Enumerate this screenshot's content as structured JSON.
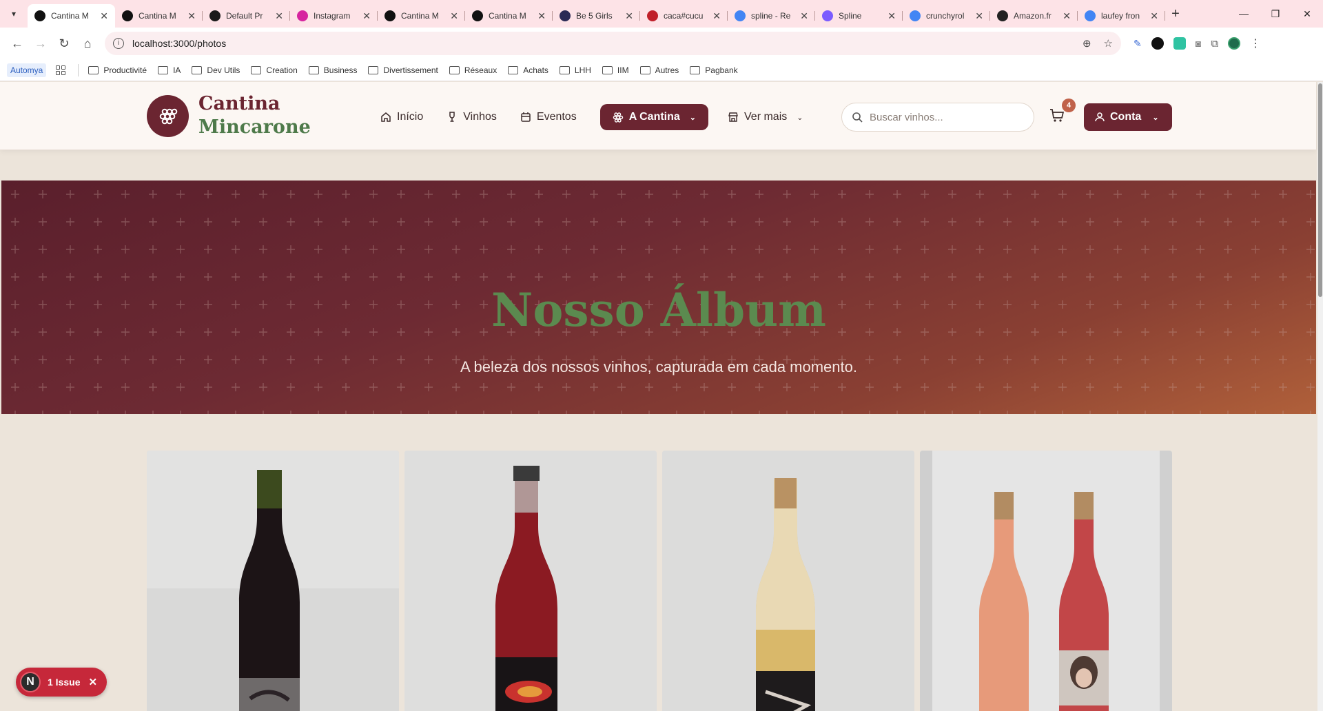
{
  "browser": {
    "tabs": [
      {
        "title": "Cantina M",
        "active": true,
        "favicon_color": "#111111"
      },
      {
        "title": "Cantina M",
        "active": false,
        "favicon_color": "#111111"
      },
      {
        "title": "Default Pr",
        "active": false,
        "favicon_color": "#1a1a1a"
      },
      {
        "title": "Instagram",
        "active": false,
        "favicon_color": "#d6249f"
      },
      {
        "title": "Cantina M",
        "active": false,
        "favicon_color": "#111111"
      },
      {
        "title": "Cantina M",
        "active": false,
        "favicon_color": "#111111"
      },
      {
        "title": "Be 5 Girls",
        "active": false,
        "favicon_color": "#2a2a55"
      },
      {
        "title": "caca#cucu",
        "active": false,
        "favicon_color": "#c0202a"
      },
      {
        "title": "spline - Re",
        "active": false,
        "favicon_color": "#4285f4"
      },
      {
        "title": "Spline",
        "active": false,
        "favicon_color": "#7b5cff"
      },
      {
        "title": "crunchyrol",
        "active": false,
        "favicon_color": "#4285f4"
      },
      {
        "title": "Amazon.fr",
        "active": false,
        "favicon_color": "#222222"
      },
      {
        "title": "laufey fron",
        "active": false,
        "favicon_color": "#4285f4"
      }
    ],
    "url": "localhost:3000/photos",
    "bookmarks": [
      "Productivité",
      "IA",
      "Dev Utils",
      "Creation",
      "Business",
      "Divertissement",
      "Réseaux",
      "Achats",
      "LHH",
      "IIM",
      "Autres",
      "Pagbank"
    ],
    "bookmark_app": "Automya"
  },
  "site": {
    "brand_line1": "Cantina",
    "brand_line2": "Mincarone",
    "nav": {
      "inicio": "Início",
      "vinhos": "Vinhos",
      "eventos": "Eventos",
      "cantina": "A Cantina",
      "ver_mais": "Ver mais"
    },
    "search_placeholder": "Buscar vinhos...",
    "cart_count": "4",
    "account": "Conta",
    "colors": {
      "wine": "#6b2531",
      "green": "#5b8a4f",
      "accent": "#c0624a"
    }
  },
  "hero": {
    "title": "Nosso Álbum",
    "subtitle": "A beleza dos nossos vinhos, capturada em cada momento."
  },
  "issues": {
    "badge_letter": "N",
    "label": "1 Issue"
  }
}
